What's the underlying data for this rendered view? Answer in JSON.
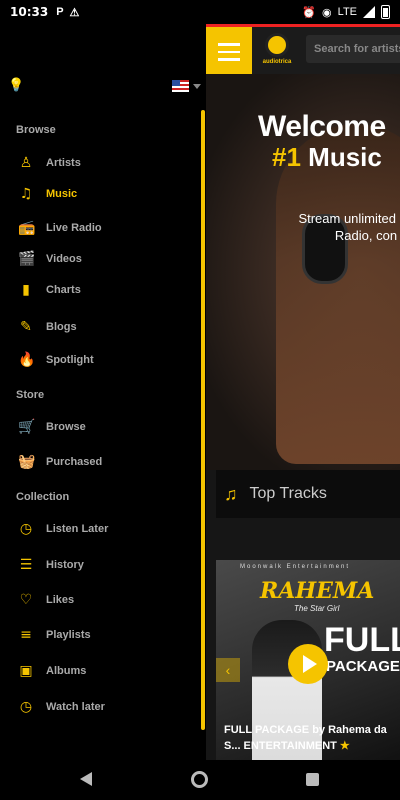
{
  "status": {
    "time": "10:33",
    "left_icons": [
      "P",
      "⚠"
    ],
    "network": "LTE"
  },
  "app": {
    "logo_text": "audiotrica",
    "search_placeholder": "Search for artists, ...",
    "hero": {
      "title": "Welcome",
      "highlight": "#1",
      "title2": "Music",
      "sub_line1": "Stream unlimited music",
      "sub_line2": "Radio, con"
    },
    "top_tracks_label": "Top Tracks",
    "album": {
      "producer_line": "Moonwalk Entertainment",
      "artist": "RAHEMA",
      "tagline": "The Star Girl",
      "title_big": "FULL",
      "title_small": "PACKAGE",
      "caption": "FULL PACKAGE by Rahema da S... ENTERTAINMENT"
    }
  },
  "drawer": {
    "sections": [
      {
        "title": "Browse",
        "items": [
          {
            "label": "Artists",
            "icon": "person-icon",
            "glyph": "♙",
            "active": false
          },
          {
            "label": "Music",
            "icon": "music-note-icon",
            "glyph": "♫",
            "active": true
          },
          {
            "label": "Live Radio",
            "icon": "radio-icon",
            "glyph": "📻",
            "active": false
          },
          {
            "label": "Videos",
            "icon": "video-icon",
            "glyph": "🎬",
            "active": false
          },
          {
            "label": "Charts",
            "icon": "bar-chart-icon",
            "glyph": "▮",
            "active": false
          },
          {
            "label": "Blogs",
            "icon": "blog-icon",
            "glyph": "✎",
            "active": false
          },
          {
            "label": "Spotlight",
            "icon": "flame-icon",
            "glyph": "🔥",
            "active": false
          }
        ]
      },
      {
        "title": "Store",
        "items": [
          {
            "label": "Browse",
            "icon": "cart-icon",
            "glyph": "🛒",
            "active": false
          },
          {
            "label": "Purchased",
            "icon": "basket-icon",
            "glyph": "🧺",
            "active": false
          }
        ]
      },
      {
        "title": "Collection",
        "items": [
          {
            "label": "Listen Later",
            "icon": "clock-icon",
            "glyph": "◷",
            "active": false
          },
          {
            "label": "History",
            "icon": "list-icon",
            "glyph": "☰",
            "active": false
          },
          {
            "label": "Likes",
            "icon": "heart-icon",
            "glyph": "♡",
            "active": false
          },
          {
            "label": "Playlists",
            "icon": "playlist-icon",
            "glyph": "≡",
            "active": false
          },
          {
            "label": "Albums",
            "icon": "album-icon",
            "glyph": "▣",
            "active": false
          },
          {
            "label": "Watch later",
            "icon": "clock-icon",
            "glyph": "◷",
            "active": false
          }
        ]
      }
    ]
  },
  "colors": {
    "accent": "#f5c400",
    "drawer_bg": "#000000",
    "label": "#aaaaaa"
  }
}
